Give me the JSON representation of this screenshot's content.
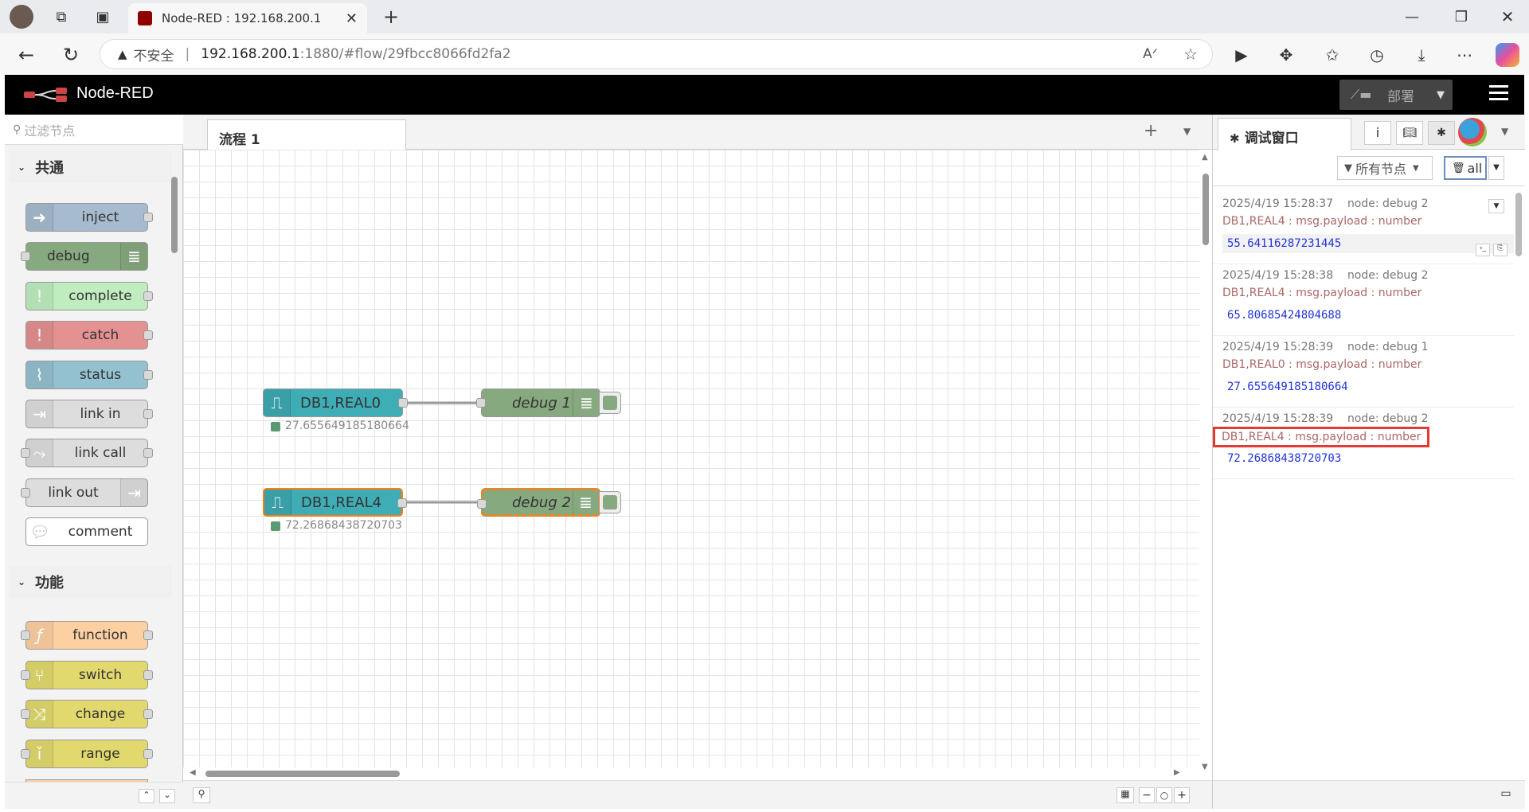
{
  "browser": {
    "tab_title": "Node-RED : 192.168.200.1",
    "security_label": "不安全",
    "url_host": "192.168.200.1",
    "url_rest": ":1880/#flow/29fbcc8066fd2fa2"
  },
  "header": {
    "app_name": "Node-RED",
    "deploy_label": "部署"
  },
  "palette": {
    "filter_placeholder": "过滤节点",
    "categories": [
      {
        "label": "共通",
        "nodes": [
          "inject",
          "debug",
          "complete",
          "catch",
          "status",
          "link in",
          "link call",
          "link out",
          "comment"
        ]
      },
      {
        "label": "功能",
        "nodes": [
          "function",
          "switch",
          "change",
          "range"
        ]
      }
    ]
  },
  "workspace": {
    "tab_label": "流程 1",
    "nodes": [
      {
        "label": "DB1,REAL0",
        "status": "27.655649185180664"
      },
      {
        "label": "debug 1"
      },
      {
        "label": "DB1,REAL4",
        "status": "72.26868438720703"
      },
      {
        "label": "debug 2"
      }
    ]
  },
  "sidebar": {
    "tab_label": "调试窗口",
    "filter_label": "所有节点",
    "clear_label": "all",
    "messages": [
      {
        "time": "2025/4/19 15:28:37",
        "node": "node: debug 2",
        "topic": "DB1,REAL4 : msg.payload : number",
        "value": "55.64116287231445"
      },
      {
        "time": "2025/4/19 15:28:38",
        "node": "node: debug 2",
        "topic": "DB1,REAL4 : msg.payload : number",
        "value": "65.80685424804688"
      },
      {
        "time": "2025/4/19 15:28:39",
        "node": "node: debug 1",
        "topic": "DB1,REAL0 : msg.payload : number",
        "value": "27.655649185180664"
      },
      {
        "time": "2025/4/19 15:28:39",
        "node": "node: debug 2",
        "topic": "DB1,REAL4 : msg.payload : number",
        "value": "72.26868438720703"
      }
    ]
  },
  "colors": {
    "inject": "#a6bbcf",
    "debug": "#87a980",
    "complete": "#c0edc0",
    "catch": "#e49191",
    "status": "#94c1d0",
    "link": "#dddddd",
    "comment": "#ffffff",
    "function": "#fdd0a2",
    "switch": "#e2d96e",
    "s7": "#3fadb5",
    "highlight": "#e53935",
    "selected": "#ff7f0e"
  }
}
